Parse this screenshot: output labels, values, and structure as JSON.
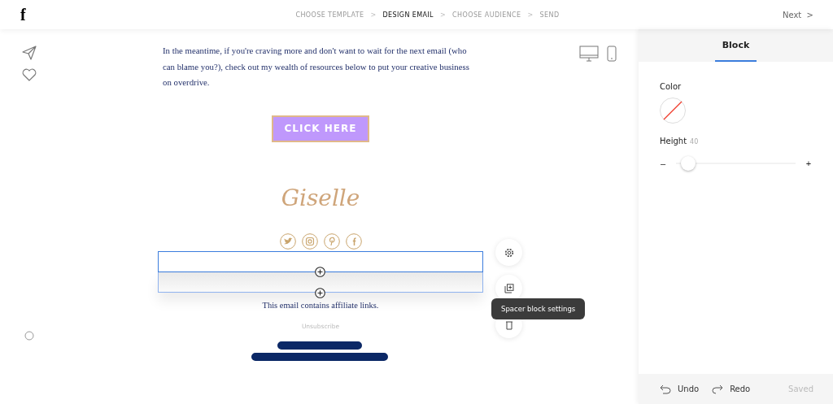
{
  "logo": "f",
  "steps": [
    {
      "label": "CHOOSE TEMPLATE",
      "selected": false
    },
    {
      "label": "DESIGN EMAIL",
      "selected": true
    },
    {
      "label": "CHOOSE AUDIENCE",
      "selected": false
    },
    {
      "label": "SEND",
      "selected": false
    }
  ],
  "step_separator": ">",
  "next_button": {
    "label": "Next  >"
  },
  "email": {
    "paragraph": "In the meantime, if you're craving more and don't want to wait for the next email (who can blame you?), check out my wealth of resources below to put your creative business on overdrive.",
    "cta": "CLICK HERE",
    "signature": "Giselle",
    "socials": [
      {
        "kind": "twitter"
      },
      {
        "kind": "instagram"
      },
      {
        "kind": "pinterest"
      },
      {
        "kind": "facebook"
      }
    ],
    "spacers": [
      {
        "selected": true
      },
      {
        "selected": false
      }
    ],
    "footer": "This email contains affiliate links.",
    "unsubscribe": "Unsubscribe"
  },
  "tooltip": "Spacer block settings",
  "panel": {
    "tabs": [
      {
        "label": "Block",
        "selected": true
      }
    ],
    "color_label": "Color",
    "height_label": "Height",
    "height_value": "40",
    "minus": "–",
    "plus": "+",
    "level": 0.1,
    "undo": "Undo",
    "redo": "Redo",
    "status": "Saved"
  }
}
